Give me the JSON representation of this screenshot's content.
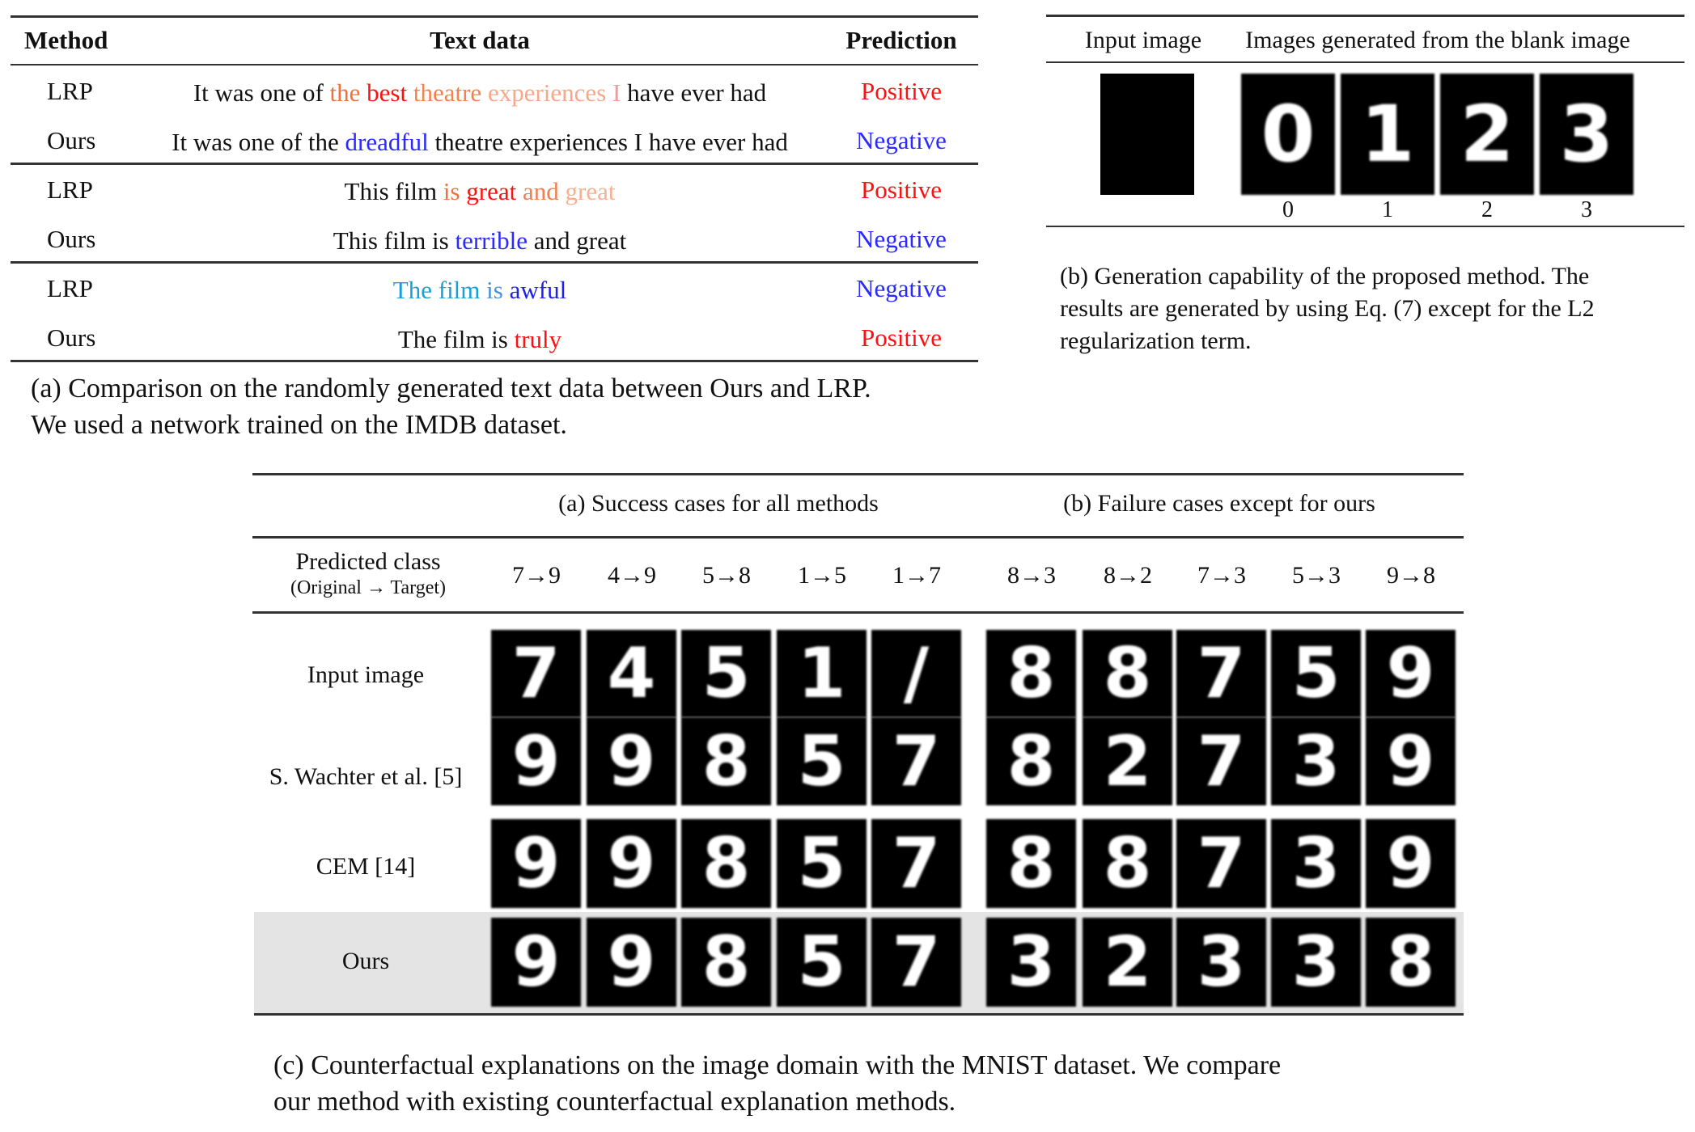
{
  "panel_a": {
    "headers": [
      "Method",
      "Text data",
      "Prediction"
    ],
    "rows": [
      {
        "method": "LRP",
        "segments": [
          {
            "text": "It was one of ",
            "color": "#111111"
          },
          {
            "text": "the ",
            "color": "#f07040"
          },
          {
            "text": "best ",
            "color": "#ff1010"
          },
          {
            "text": "theatre ",
            "color": "#f58050"
          },
          {
            "text": "experiences ",
            "color": "#f8a888"
          },
          {
            "text": "I ",
            "color": "#f59a9a"
          },
          {
            "text": "have ever had",
            "color": "#111111"
          }
        ],
        "prediction": "Positive",
        "pred_color": "#ff1010"
      },
      {
        "method": "Ours",
        "segments": [
          {
            "text": "It was one of the ",
            "color": "#111111"
          },
          {
            "text": "dreadful ",
            "color": "#2a2aff"
          },
          {
            "text": "theatre experiences I have ever had",
            "color": "#111111"
          }
        ],
        "prediction": "Negative",
        "pred_color": "#2a2aff"
      },
      {
        "method": "LRP",
        "segments": [
          {
            "text": "This film ",
            "color": "#111111"
          },
          {
            "text": "is ",
            "color": "#f07040"
          },
          {
            "text": "great ",
            "color": "#ff1010"
          },
          {
            "text": "and ",
            "color": "#f08050"
          },
          {
            "text": "great",
            "color": "#f8b090"
          }
        ],
        "prediction": "Positive",
        "pred_color": "#ff1010"
      },
      {
        "method": "Ours",
        "segments": [
          {
            "text": "This film is ",
            "color": "#111111"
          },
          {
            "text": "terrible ",
            "color": "#2a2aff"
          },
          {
            "text": "and great",
            "color": "#111111"
          }
        ],
        "prediction": "Negative",
        "pred_color": "#2a2aff"
      },
      {
        "method": "LRP",
        "segments": [
          {
            "text": "The film ",
            "color": "#1aa0d8"
          },
          {
            "text": "is ",
            "color": "#4a90d8"
          },
          {
            "text": "awful",
            "color": "#2020ee"
          }
        ],
        "prediction": "Negative",
        "pred_color": "#2a2aff"
      },
      {
        "method": "Ours",
        "segments": [
          {
            "text": "The film is ",
            "color": "#111111"
          },
          {
            "text": "truly",
            "color": "#ff1010"
          }
        ],
        "prediction": "Positive",
        "pred_color": "#ff1010"
      }
    ],
    "caption": [
      "(a) Comparison on the randomly generated text data between Ours and LRP.",
      "We used a network trained on the IMDB dataset."
    ]
  },
  "panel_b": {
    "headers": [
      "Input image",
      "Images generated from the blank image"
    ],
    "labels": [
      "0",
      "1",
      "2",
      "3"
    ],
    "caption": [
      "(b) Generation capability of the proposed method. The",
      "results are generated by using Eq. (7) except for the L2",
      "regularization term."
    ]
  },
  "panel_c": {
    "group_headers": [
      "(a) Success cases for all methods",
      "(b) Failure cases except for ours"
    ],
    "predicted_class_label": "Predicted class",
    "predicted_class_sub": "(Original → Target)",
    "transitions": [
      "7→9",
      "4→9",
      "5→8",
      "1→5",
      "1→7",
      "8→3",
      "8→2",
      "7→3",
      "5→3",
      "9→8"
    ],
    "row_labels": [
      "Input image",
      "S. Wachter et al. [5]",
      "CEM [14]",
      "Ours"
    ],
    "highlight_color": "#e4e4e4",
    "caption": [
      "(c) Counterfactual explanations on the image domain with the MNIST dataset. We compare",
      "our method with existing counterfactual explanation methods."
    ]
  }
}
